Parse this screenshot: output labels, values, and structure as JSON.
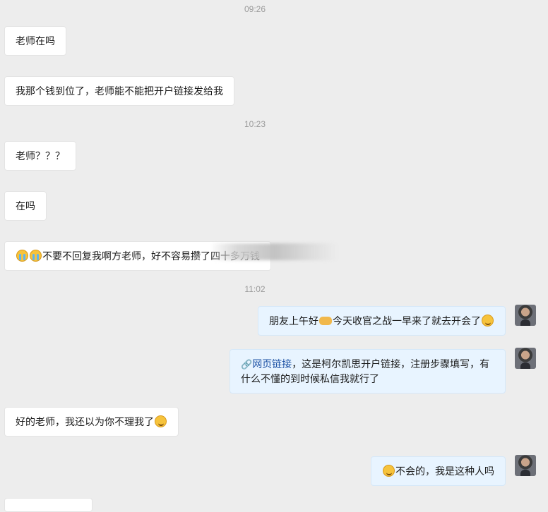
{
  "timestamps": [
    "09:26",
    "10:23",
    "11:02"
  ],
  "messages": [
    {
      "text": "老师在吗"
    },
    {
      "text": "我那个钱到位了，老师能不能把开户链接发给我"
    },
    {
      "text": "老师？？？"
    },
    {
      "text": "在吗"
    },
    {
      "text": "不要不回复我啊方老师，好不容易攒了四十多万钱"
    },
    {
      "text_a": "朋友上午好",
      "text_b": "今天收官之战一早来了就去开会了"
    },
    {
      "link_label": "网页链接",
      "text": "，这是柯尔凯思开户链接，注册步骤填写，有什么不懂的到时候私信我就行了"
    },
    {
      "text": "好的老师，我还以为你不理我了"
    },
    {
      "text": "不会的，我是这种人吗"
    }
  ],
  "icons": {
    "cry": "loudly-crying-face",
    "smirk": "smirking-face",
    "handshake": "handshake",
    "link": "link-icon"
  },
  "colors": {
    "background": "#ededed",
    "incoming_bubble": "#ffffff",
    "outgoing_bubble": "#e8f4ff",
    "link": "#1a4fa3"
  }
}
